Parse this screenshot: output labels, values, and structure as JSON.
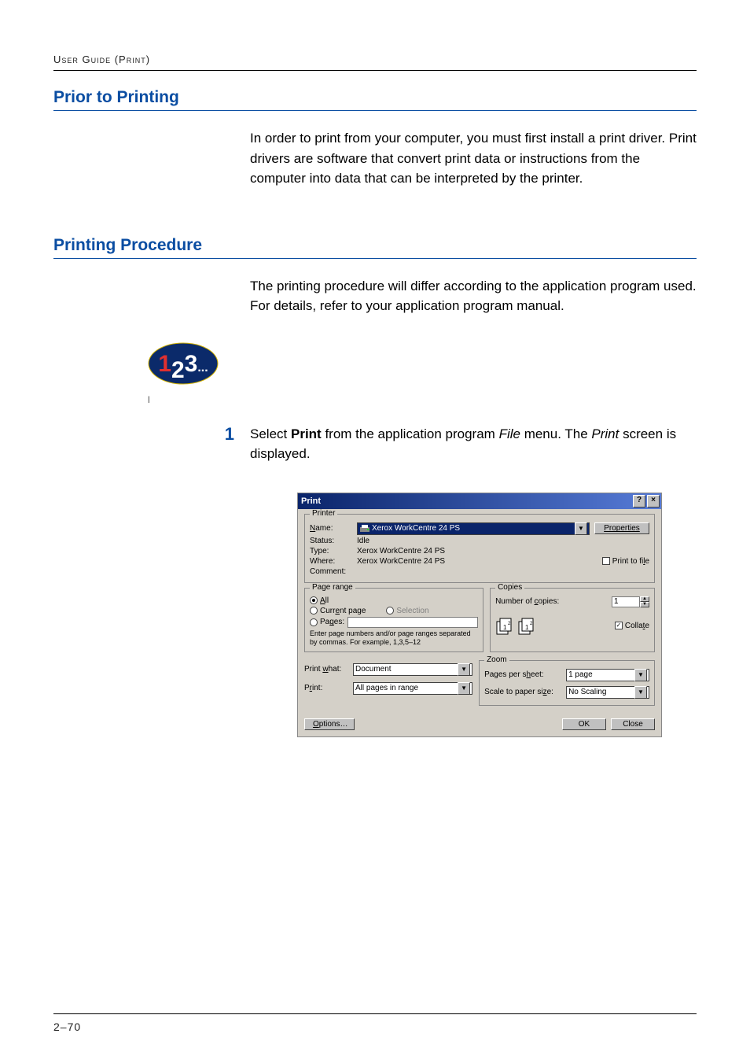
{
  "running_head": "User Guide (Print)",
  "sec1_title": "Prior to Printing",
  "sec1_body": "In order to print from your computer, you must first install a print driver. Print drivers are software that convert print data or instructions from the computer into data that can be interpreted by the printer.",
  "sec2_title": "Printing Procedure",
  "sec2_intro": "The printing procedure will differ according to the application program used. For details, refer to your application program manual.",
  "step1_num": "1",
  "step1_select": "Select ",
  "step1_print_bold": "Print",
  "step1_mid": " from the application program ",
  "step1_file_italic": "File",
  "step1_mid2": " menu. The ",
  "step1_print_italic": "Print",
  "step1_end": " screen is displayed.",
  "dlg": {
    "title": "Print",
    "help": "?",
    "close": "×",
    "printer_legend": "Printer",
    "name_label": "Name:",
    "name_value": "Xerox WorkCentre 24 PS",
    "properties": "Properties",
    "status_label": "Status:",
    "status_value": "Idle",
    "type_label": "Type:",
    "type_value": "Xerox WorkCentre 24 PS",
    "where_label": "Where:",
    "where_value": "Xerox WorkCentre 24 PS",
    "comment_label": "Comment:",
    "print_to_file": "Print to file",
    "pagerange_legend": "Page range",
    "all": "All",
    "current_page": "Current page",
    "selection": "Selection",
    "pages": "Pages:",
    "pages_help": "Enter page numbers and/or page ranges separated by commas. For example, 1,3,5–12",
    "copies_legend": "Copies",
    "num_copies": "Number of copies:",
    "num_copies_val": "1",
    "collate": "Collate",
    "print_what_label": "Print what:",
    "print_what_val": "Document",
    "print_label": "Print:",
    "print_val": "All pages in range",
    "zoom_legend": "Zoom",
    "pps": "Pages per sheet:",
    "pps_val": "1 page",
    "scale": "Scale to paper size:",
    "scale_val": "No Scaling",
    "options": "Options…",
    "ok": "OK",
    "close_btn": "Close"
  },
  "page_number": "2–70"
}
